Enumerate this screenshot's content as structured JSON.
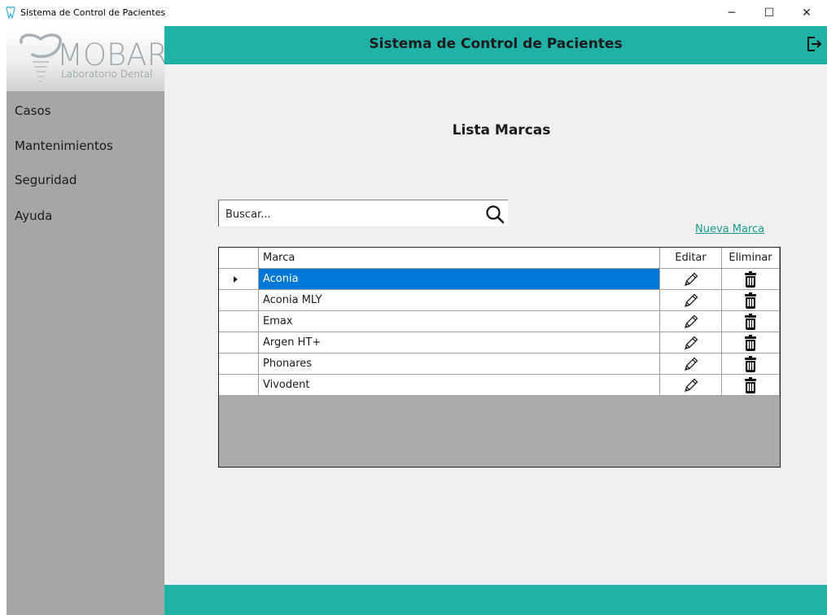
{
  "window": {
    "title": "Sistema de Control de Pacientes",
    "controls": {
      "minimize": "─",
      "maximize": "☐",
      "close": "✕"
    }
  },
  "sidebar": {
    "logo_text": "MOBAR",
    "logo_subtext": "Laboratorio Dental",
    "items": [
      {
        "label": "Casos"
      },
      {
        "label": "Mantenimientos"
      },
      {
        "label": "Seguridad"
      },
      {
        "label": "Ayuda"
      }
    ]
  },
  "header": {
    "title": "Sistema de Control de Pacientes",
    "logout_icon": "logout-icon"
  },
  "main": {
    "title": "Lista Marcas",
    "search": {
      "placeholder": "Buscar...",
      "icon": "search-icon"
    },
    "new_link": "Nueva Marca",
    "grid": {
      "columns": [
        "Marca",
        "Editar",
        "Eliminar"
      ],
      "selected_index": 0,
      "rows": [
        {
          "marca": "Aconia"
        },
        {
          "marca": "Aconia MLY"
        },
        {
          "marca": "Emax"
        },
        {
          "marca": "Argen HT+"
        },
        {
          "marca": "Phonares"
        },
        {
          "marca": "Vivodent"
        }
      ],
      "edit_icon": "pencil-icon",
      "delete_icon": "trash-icon"
    }
  },
  "colors": {
    "accent": "#20b2a6",
    "sidebar": "#a6a6a6",
    "selection": "#0078d7",
    "link": "#1a9a8e"
  }
}
